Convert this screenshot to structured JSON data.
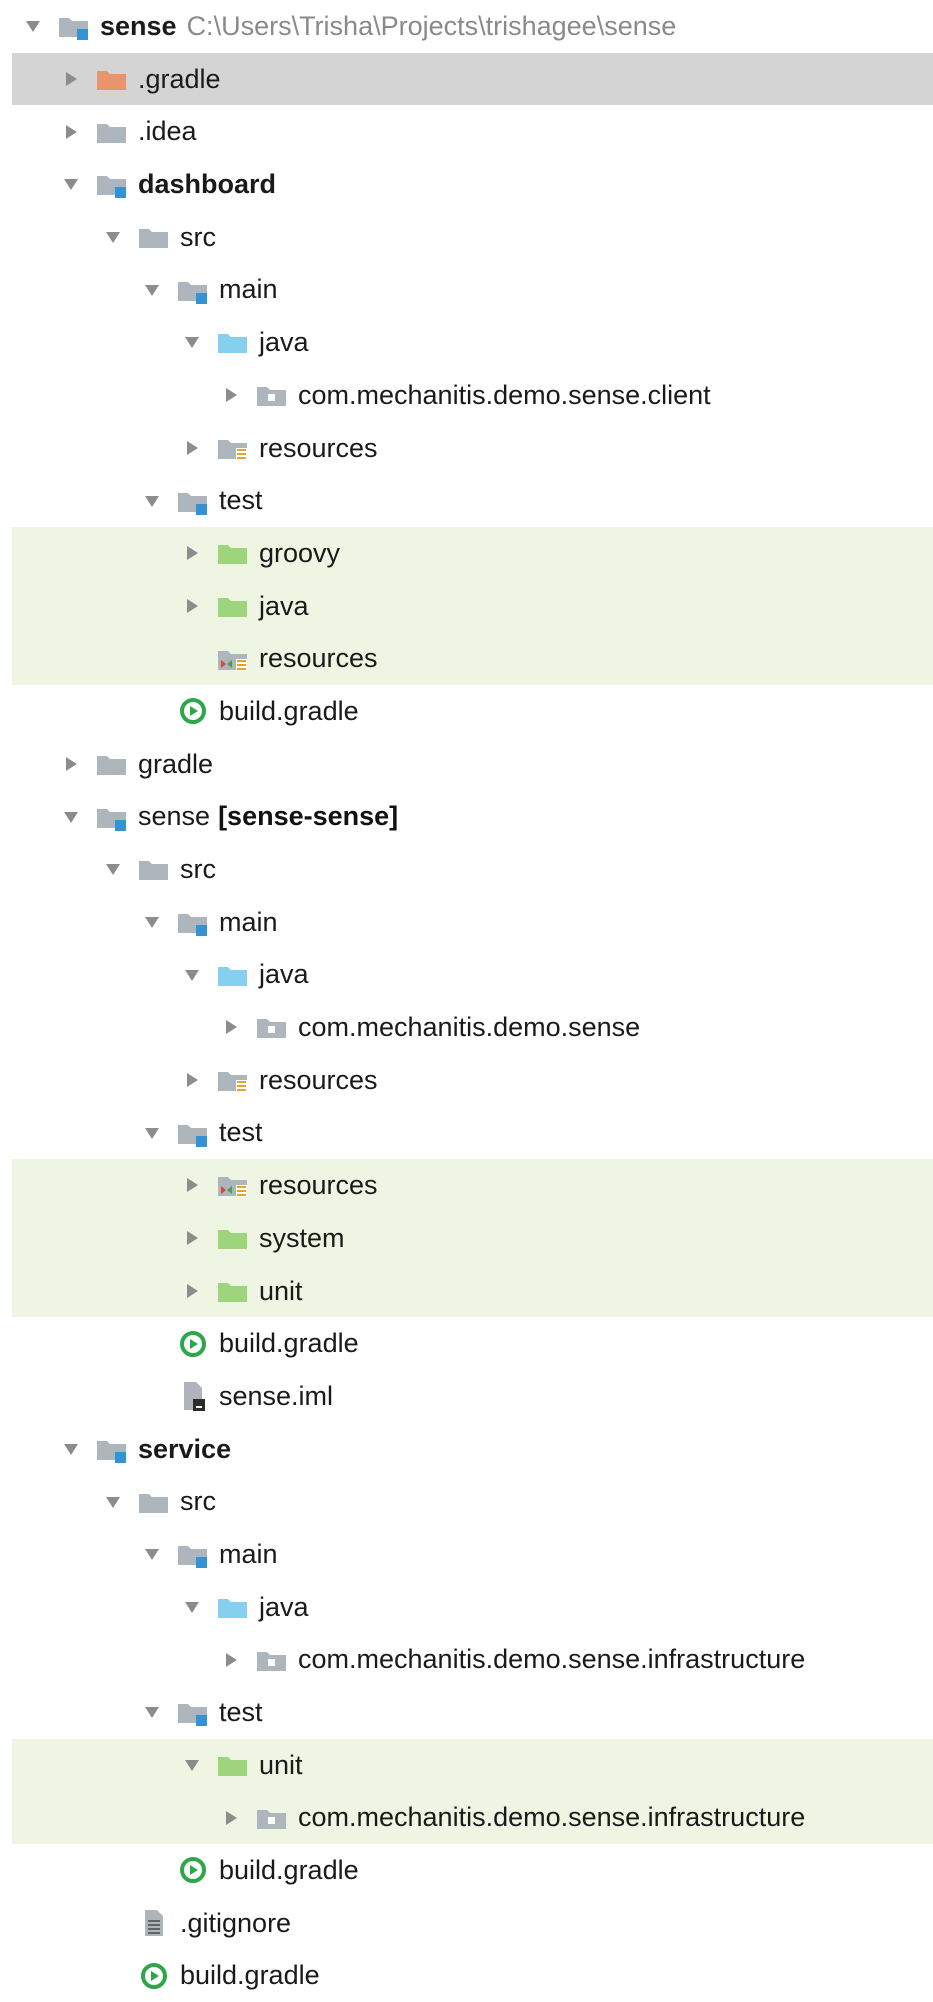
{
  "tree": [
    {
      "depth": 0,
      "expanded": true,
      "icon": "module-folder-icon",
      "label": "sense",
      "bold": true,
      "extra": "C:\\Users\\Trisha\\Projects\\trishagee\\sense",
      "bg": ""
    },
    {
      "depth": 1,
      "expanded": false,
      "icon": "excluded-folder-icon",
      "label": ".gradle",
      "bg": "selected"
    },
    {
      "depth": 1,
      "expanded": false,
      "icon": "folder-icon",
      "label": ".idea",
      "bg": ""
    },
    {
      "depth": 1,
      "expanded": true,
      "icon": "module-folder-icon",
      "label": "dashboard",
      "bold": true,
      "bg": ""
    },
    {
      "depth": 2,
      "expanded": true,
      "icon": "folder-icon",
      "label": "src",
      "bg": ""
    },
    {
      "depth": 3,
      "expanded": true,
      "icon": "module-folder-icon",
      "label": "main",
      "bg": ""
    },
    {
      "depth": 4,
      "expanded": true,
      "icon": "source-root-icon",
      "label": "java",
      "bg": ""
    },
    {
      "depth": 5,
      "expanded": false,
      "icon": "package-icon",
      "label": "com.mechanitis.demo.sense.client",
      "bg": ""
    },
    {
      "depth": 4,
      "expanded": false,
      "icon": "resources-root-icon",
      "label": "resources",
      "bg": ""
    },
    {
      "depth": 3,
      "expanded": true,
      "icon": "module-folder-icon",
      "label": "test",
      "bg": ""
    },
    {
      "depth": 4,
      "expanded": false,
      "icon": "test-source-root-icon",
      "label": "groovy",
      "bg": "test"
    },
    {
      "depth": 4,
      "expanded": false,
      "icon": "test-source-root-icon",
      "label": "java",
      "bg": "test"
    },
    {
      "depth": 4,
      "expanded": null,
      "icon": "test-resources-root-icon",
      "label": "resources",
      "bg": "test"
    },
    {
      "depth": 3,
      "expanded": null,
      "icon": "gradle-file-icon",
      "label": "build.gradle",
      "bg": ""
    },
    {
      "depth": 1,
      "expanded": false,
      "icon": "folder-icon",
      "label": "gradle",
      "bg": ""
    },
    {
      "depth": 1,
      "expanded": true,
      "icon": "module-folder-icon",
      "label": "sense",
      "suffix": "[sense-sense]",
      "bg": ""
    },
    {
      "depth": 2,
      "expanded": true,
      "icon": "folder-icon",
      "label": "src",
      "bg": ""
    },
    {
      "depth": 3,
      "expanded": true,
      "icon": "module-folder-icon",
      "label": "main",
      "bg": ""
    },
    {
      "depth": 4,
      "expanded": true,
      "icon": "source-root-icon",
      "label": "java",
      "bg": ""
    },
    {
      "depth": 5,
      "expanded": false,
      "icon": "package-icon",
      "label": "com.mechanitis.demo.sense",
      "bg": ""
    },
    {
      "depth": 4,
      "expanded": false,
      "icon": "resources-root-icon",
      "label": "resources",
      "bg": ""
    },
    {
      "depth": 3,
      "expanded": true,
      "icon": "module-folder-icon",
      "label": "test",
      "bg": ""
    },
    {
      "depth": 4,
      "expanded": false,
      "icon": "test-resources-root-icon",
      "label": "resources",
      "bg": "test"
    },
    {
      "depth": 4,
      "expanded": false,
      "icon": "test-source-root-icon",
      "label": "system",
      "bg": "test"
    },
    {
      "depth": 4,
      "expanded": false,
      "icon": "test-source-root-icon",
      "label": "unit",
      "bg": "test"
    },
    {
      "depth": 3,
      "expanded": null,
      "icon": "gradle-file-icon",
      "label": "build.gradle",
      "bg": ""
    },
    {
      "depth": 3,
      "expanded": null,
      "icon": "iml-file-icon",
      "label": "sense.iml",
      "bg": ""
    },
    {
      "depth": 1,
      "expanded": true,
      "icon": "module-folder-icon",
      "label": "service",
      "bold": true,
      "bg": ""
    },
    {
      "depth": 2,
      "expanded": true,
      "icon": "folder-icon",
      "label": "src",
      "bg": ""
    },
    {
      "depth": 3,
      "expanded": true,
      "icon": "module-folder-icon",
      "label": "main",
      "bg": ""
    },
    {
      "depth": 4,
      "expanded": true,
      "icon": "source-root-icon",
      "label": "java",
      "bg": ""
    },
    {
      "depth": 5,
      "expanded": false,
      "icon": "package-icon",
      "label": "com.mechanitis.demo.sense.infrastructure",
      "bg": ""
    },
    {
      "depth": 3,
      "expanded": true,
      "icon": "module-folder-icon",
      "label": "test",
      "bg": ""
    },
    {
      "depth": 4,
      "expanded": true,
      "icon": "test-source-root-icon",
      "label": "unit",
      "bg": "test"
    },
    {
      "depth": 5,
      "expanded": false,
      "icon": "package-icon",
      "label": "com.mechanitis.demo.sense.infrastructure",
      "bg": "test"
    },
    {
      "depth": 3,
      "expanded": null,
      "icon": "gradle-file-icon",
      "label": "build.gradle",
      "bg": ""
    },
    {
      "depth": 2,
      "expanded": null,
      "icon": "text-file-icon",
      "label": ".gitignore",
      "bg": ""
    },
    {
      "depth": 2,
      "expanded": null,
      "icon": "gradle-file-icon",
      "label": "build.gradle",
      "bg": ""
    }
  ],
  "colors": {
    "folder": "#adb5bd",
    "module_badge": "#3592d3",
    "excluded": "#e8956b",
    "source_root": "#87cfee",
    "test_root": "#9ed47c",
    "gradle": "#2ea74b",
    "selected_bg": "#d4d4d4",
    "test_bg": "#eef5e3"
  }
}
